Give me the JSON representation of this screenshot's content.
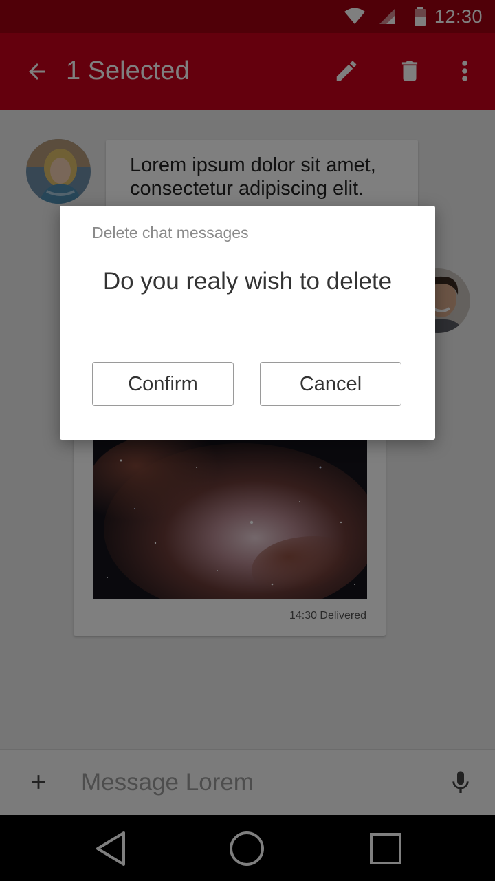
{
  "status_bar": {
    "time": "12:30",
    "icons": [
      "wifi-icon",
      "cell-signal-icon",
      "battery-icon"
    ]
  },
  "app_bar": {
    "title": "1 Selected",
    "icons": [
      "back-arrow-icon",
      "edit-pencil-icon",
      "trash-icon",
      "more-vert-icon"
    ],
    "color": "#c8001a"
  },
  "chat": {
    "messages": [
      {
        "text": "Lorem ipsum dolor sit amet, consectetur adipiscing elit."
      },
      {
        "type": "image",
        "meta": "14:30 Delivered"
      }
    ]
  },
  "input_bar": {
    "placeholder": "Message Lorem",
    "icons": [
      "plus-icon",
      "microphone-icon"
    ]
  },
  "nav_bar": {
    "icons": [
      "back-triangle-icon",
      "home-circle-icon",
      "recents-square-icon"
    ]
  },
  "dialog": {
    "title": "Delete chat messages",
    "message": "Do you realy wish to delete",
    "confirm_label": "Confirm",
    "cancel_label": "Cancel"
  }
}
